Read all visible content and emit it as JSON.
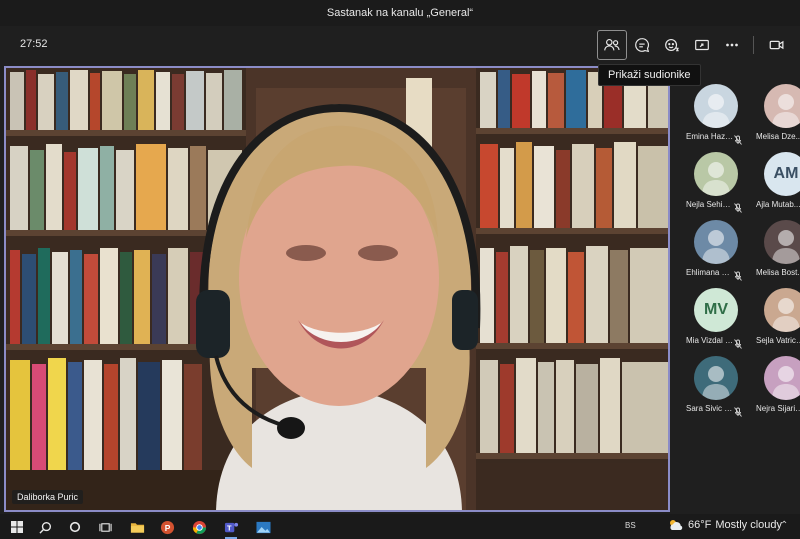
{
  "window": {
    "title": "Sastanak na kanalu „General“"
  },
  "toolbar": {
    "timer": "27:52",
    "participants_tooltip": "Prikaži sudionike",
    "buttons": [
      "people-icon",
      "chat-icon",
      "reactions-icon",
      "share-icon",
      "more-icon",
      "camera-icon"
    ]
  },
  "video": {
    "speaker_name": "Daliborka Puric"
  },
  "roster": [
    {
      "name": "Emina Hazn...",
      "initials": "",
      "avatar_color": "#c9d6e0",
      "muted": true
    },
    {
      "name": "Melisa Dze...",
      "initials": "",
      "avatar_color": "#d6b9b2",
      "muted": true
    },
    {
      "name": "Nejla Sehic ...",
      "initials": "",
      "avatar_color": "#b9c8a6",
      "muted": true
    },
    {
      "name": "Ajla Mutab...",
      "initials": "AM",
      "avatar_color": "#d9e6ef",
      "muted": true
    },
    {
      "name": "Ehlimana Se...",
      "initials": "",
      "avatar_color": "#6d8aa6",
      "muted": true
    },
    {
      "name": "Melisa Bost...",
      "initials": "",
      "avatar_color": "#5a4a4a",
      "muted": true
    },
    {
      "name": "Mia Vizdal (...",
      "initials": "MV",
      "avatar_color": "#cfe8d6",
      "muted": true
    },
    {
      "name": "Sejla Vatric (...",
      "initials": "",
      "avatar_color": "#caa890",
      "muted": true
    },
    {
      "name": "Sara Sivic (S...",
      "initials": "",
      "avatar_color": "#3e6b7a",
      "muted": true
    },
    {
      "name": "Nejra Sijaric...",
      "initials": "",
      "avatar_color": "#c7a0c0",
      "muted": true
    }
  ],
  "taskbar": {
    "language": "BS",
    "weather_temp": "66°F",
    "weather_text": "Mostly cloudy"
  }
}
